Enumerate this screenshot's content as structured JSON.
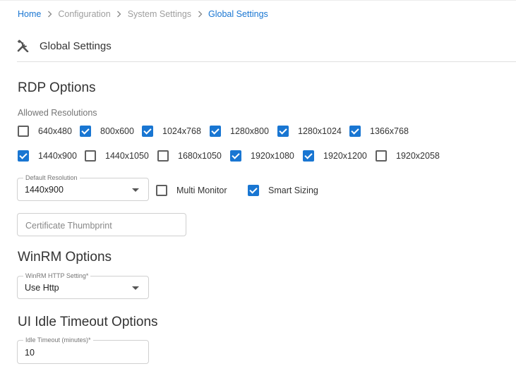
{
  "breadcrumb": {
    "home": "Home",
    "configuration": "Configuration",
    "system_settings": "System Settings",
    "global_settings": "Global Settings"
  },
  "header": {
    "title": "Global Settings",
    "icon": "tools-icon"
  },
  "rdp": {
    "heading": "RDP Options",
    "allowed_resolutions_label": "Allowed Resolutions",
    "resolutions": [
      {
        "label": "640x480",
        "checked": false
      },
      {
        "label": "800x600",
        "checked": true
      },
      {
        "label": "1024x768",
        "checked": true
      },
      {
        "label": "1280x800",
        "checked": true
      },
      {
        "label": "1280x1024",
        "checked": true
      },
      {
        "label": "1366x768",
        "checked": true
      },
      {
        "label": "1440x900",
        "checked": true
      },
      {
        "label": "1440x1050",
        "checked": false
      },
      {
        "label": "1680x1050",
        "checked": false
      },
      {
        "label": "1920x1080",
        "checked": true
      },
      {
        "label": "1920x1200",
        "checked": true
      },
      {
        "label": "1920x2058",
        "checked": false
      }
    ],
    "default_resolution": {
      "label": "Default Resolution",
      "value": "1440x900"
    },
    "multi_monitor": {
      "label": "Multi Monitor",
      "checked": false
    },
    "smart_sizing": {
      "label": "Smart Sizing",
      "checked": true
    },
    "certificate_thumbprint": {
      "placeholder": "Certificate Thumbprint",
      "value": ""
    }
  },
  "winrm": {
    "heading": "WinRM Options",
    "http_setting": {
      "label": "WinRM HTTP Setting*",
      "value": "Use Http"
    }
  },
  "idle": {
    "heading": "UI Idle Timeout Options",
    "timeout": {
      "label": "Idle Timeout (minutes)*",
      "value": "10"
    }
  },
  "colors": {
    "accent": "#1976d2",
    "muted": "#9e9e9e",
    "border": "#d0d0d0"
  }
}
